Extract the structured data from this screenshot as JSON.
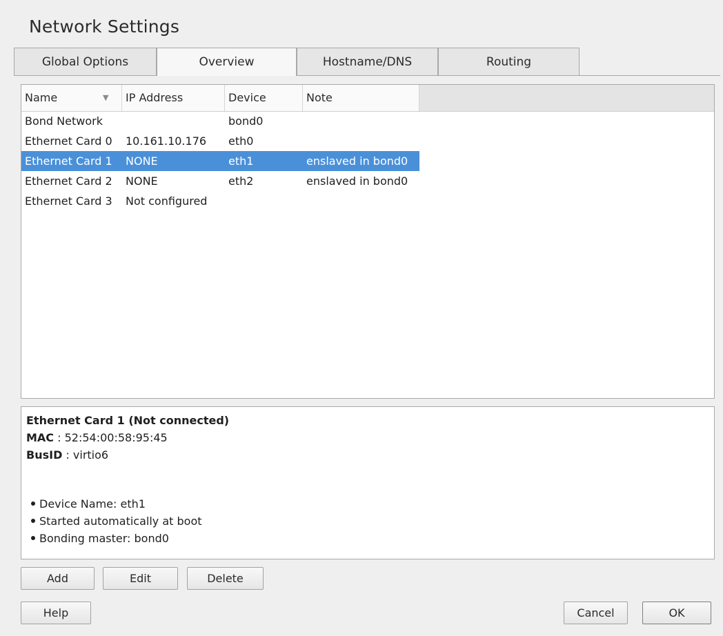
{
  "window": {
    "title": "Network Settings"
  },
  "tabs": [
    {
      "label": "Global Options",
      "active": false
    },
    {
      "label": "Overview",
      "active": true
    },
    {
      "label": "Hostname/DNS",
      "active": false
    },
    {
      "label": "Routing",
      "active": false
    }
  ],
  "table": {
    "columns": [
      "Name",
      "IP Address",
      "Device",
      "Note"
    ],
    "sort_icon": "chevron-down-icon",
    "rows": [
      {
        "name": "Bond Network",
        "ip": "",
        "device": "bond0",
        "note": ""
      },
      {
        "name": "Ethernet Card 0",
        "ip": "10.161.10.176",
        "device": "eth0",
        "note": ""
      },
      {
        "name": "Ethernet Card 1",
        "ip": "NONE",
        "device": "eth1",
        "note": "enslaved in bond0",
        "selected": true
      },
      {
        "name": "Ethernet Card 2",
        "ip": "NONE",
        "device": "eth2",
        "note": "enslaved in bond0"
      },
      {
        "name": "Ethernet Card 3",
        "ip": "Not configured",
        "device": "",
        "note": ""
      }
    ]
  },
  "details": {
    "heading": "Ethernet Card 1 (Not connected)",
    "mac_label": "MAC",
    "mac_value": " : 52:54:00:58:95:45",
    "busid_label": "BusID",
    "busid_value": " : virtio6",
    "bullets": [
      "Device Name: eth1",
      "Started automatically at boot",
      "Bonding master: bond0"
    ]
  },
  "buttons": {
    "add": "Add",
    "edit": "Edit",
    "delete": "Delete",
    "help": "Help",
    "cancel": "Cancel",
    "ok": "OK"
  },
  "colors": {
    "selection": "#4a90d9",
    "window_bg": "#efefef"
  }
}
